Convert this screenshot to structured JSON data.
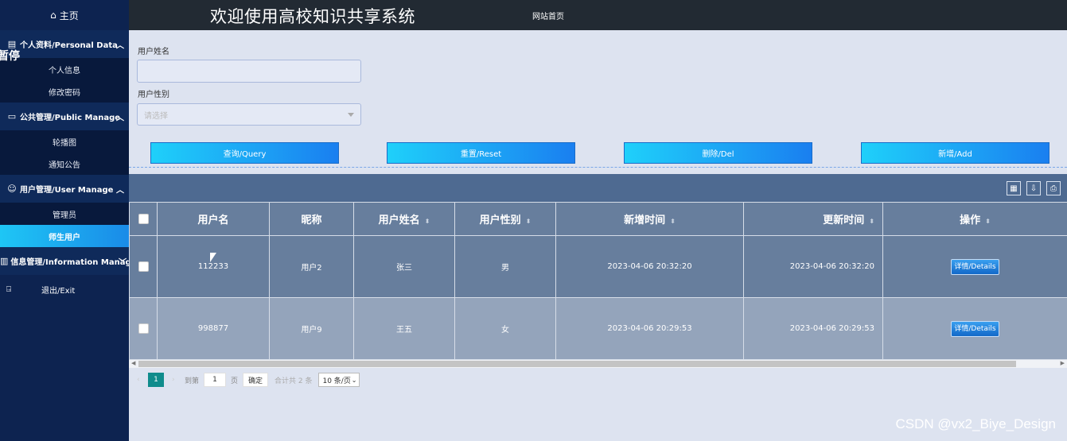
{
  "sidebar": {
    "home": "主页",
    "groups": [
      {
        "label": "个人资料/Personal Data",
        "items": [
          "个人信息",
          "修改密码"
        ]
      },
      {
        "label": "公共管理/Public Manage",
        "items": [
          "轮播图",
          "通知公告"
        ]
      },
      {
        "label": "用户管理/User Manage",
        "items": [
          "管理员",
          "师生用户"
        ]
      },
      {
        "label": "信息管理/Information Manage",
        "items": []
      }
    ],
    "exit": "退出/Exit",
    "overlay": "暂停"
  },
  "header": {
    "title": "欢迎使用高校知识共享系统",
    "site_link": "网站首页"
  },
  "search": {
    "name_label": "用户姓名",
    "name_value": "",
    "gender_label": "用户性别",
    "gender_placeholder": "请选择"
  },
  "actions": {
    "query": "查询/Query",
    "reset": "重置/Reset",
    "delete": "删除/Del",
    "add": "新增/Add"
  },
  "table": {
    "headers": [
      "用户名",
      "昵称",
      "用户姓名",
      "用户性别",
      "新增时间",
      "更新时间",
      "操作"
    ],
    "rows": [
      {
        "username": "112233",
        "nickname": "用户2",
        "realname": "张三",
        "gender": "男",
        "created": "2023-04-06 20:32:20",
        "updated": "2023-04-06 20:32:20",
        "action": "详情/Details"
      },
      {
        "username": "998877",
        "nickname": "用户9",
        "realname": "王五",
        "gender": "女",
        "created": "2023-04-06 20:29:53",
        "updated": "2023-04-06 20:29:53",
        "action": "详情/Details"
      }
    ]
  },
  "pagination": {
    "current": "1",
    "goto_label": "到第",
    "goto_value": "1",
    "page_unit": "页",
    "confirm": "确定",
    "total": "合计共 2 条",
    "page_size": "10 条/页"
  },
  "watermark": "CSDN @vx2_Biye_Design"
}
